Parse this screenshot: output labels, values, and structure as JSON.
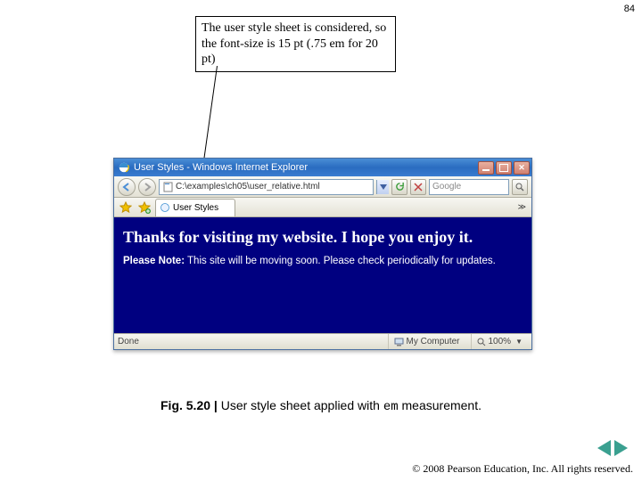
{
  "page_number": "84",
  "callout": "The user style sheet is considered, so the font-size is 15 pt (.75 em for 20 pt)",
  "titlebar": {
    "title": "User Styles - Windows Internet Explorer"
  },
  "address_bar": {
    "path": "C:\\examples\\ch05\\user_relative.html",
    "search_placeholder": "Google"
  },
  "tab": {
    "label": "User Styles"
  },
  "page": {
    "headline": "Thanks for visiting my website. I hope you enjoy it.",
    "note_label": "Please Note:",
    "note_text": " This site will be moving soon. Please check periodically for updates."
  },
  "statusbar": {
    "left": "Done",
    "zone": "My Computer",
    "zoom": "100%"
  },
  "caption": {
    "fig_label": "Fig. 5.20 |",
    "before_em": " User style sheet applied with ",
    "code": "em",
    "after_em": " measurement."
  },
  "footer": "© 2008 Pearson Education, Inc.  All rights reserved."
}
